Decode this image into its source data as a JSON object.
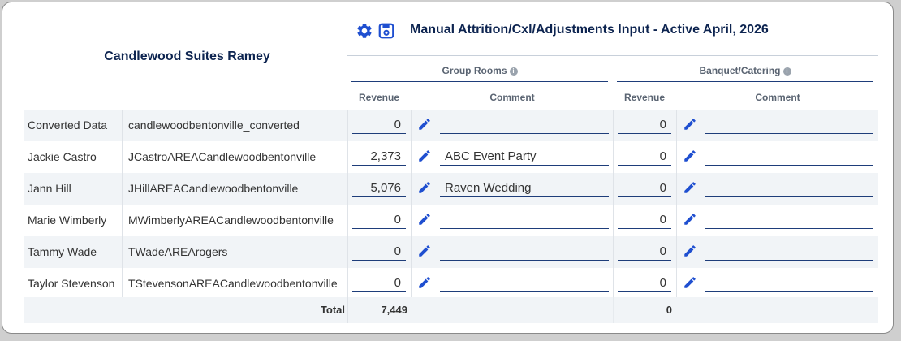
{
  "header": {
    "hotel_name": "Candlewood Suites Ramey",
    "title": "Manual Attrition/Cxl/Adjustments Input - Active April, 2026",
    "icons": [
      "gear-icon",
      "save-icon"
    ],
    "accent_color": "#1f4fd0"
  },
  "sections": {
    "group_rooms": "Group Rooms",
    "banquet": "Banquet/Catering"
  },
  "columns": {
    "revenue": "Revenue",
    "comment": "Comment"
  },
  "rows": [
    {
      "name": "Converted Data",
      "user": "candlewoodbentonville_converted",
      "gr_revenue": "0",
      "gr_comment": "",
      "bq_revenue": "0",
      "bq_comment": ""
    },
    {
      "name": "Jackie Castro",
      "user": "JCastroAREACandlewoodbentonville",
      "gr_revenue": "2,373",
      "gr_comment": "ABC Event Party",
      "bq_revenue": "0",
      "bq_comment": ""
    },
    {
      "name": "Jann Hill",
      "user": "JHillAREACandlewoodbentonville",
      "gr_revenue": "5,076",
      "gr_comment": "Raven Wedding",
      "bq_revenue": "0",
      "bq_comment": ""
    },
    {
      "name": "Marie Wimberly",
      "user": "MWimberlyAREACandlewoodbentonville",
      "gr_revenue": "0",
      "gr_comment": "",
      "bq_revenue": "0",
      "bq_comment": ""
    },
    {
      "name": "Tammy Wade",
      "user": "TWadeAREArogers",
      "gr_revenue": "0",
      "gr_comment": "",
      "bq_revenue": "0",
      "bq_comment": ""
    },
    {
      "name": "Taylor Stevenson",
      "user": "TStevensonAREACandlewoodbentonville",
      "gr_revenue": "0",
      "gr_comment": "",
      "bq_revenue": "0",
      "bq_comment": ""
    }
  ],
  "totals": {
    "label": "Total",
    "gr_revenue": "7,449",
    "bq_revenue": "0"
  }
}
